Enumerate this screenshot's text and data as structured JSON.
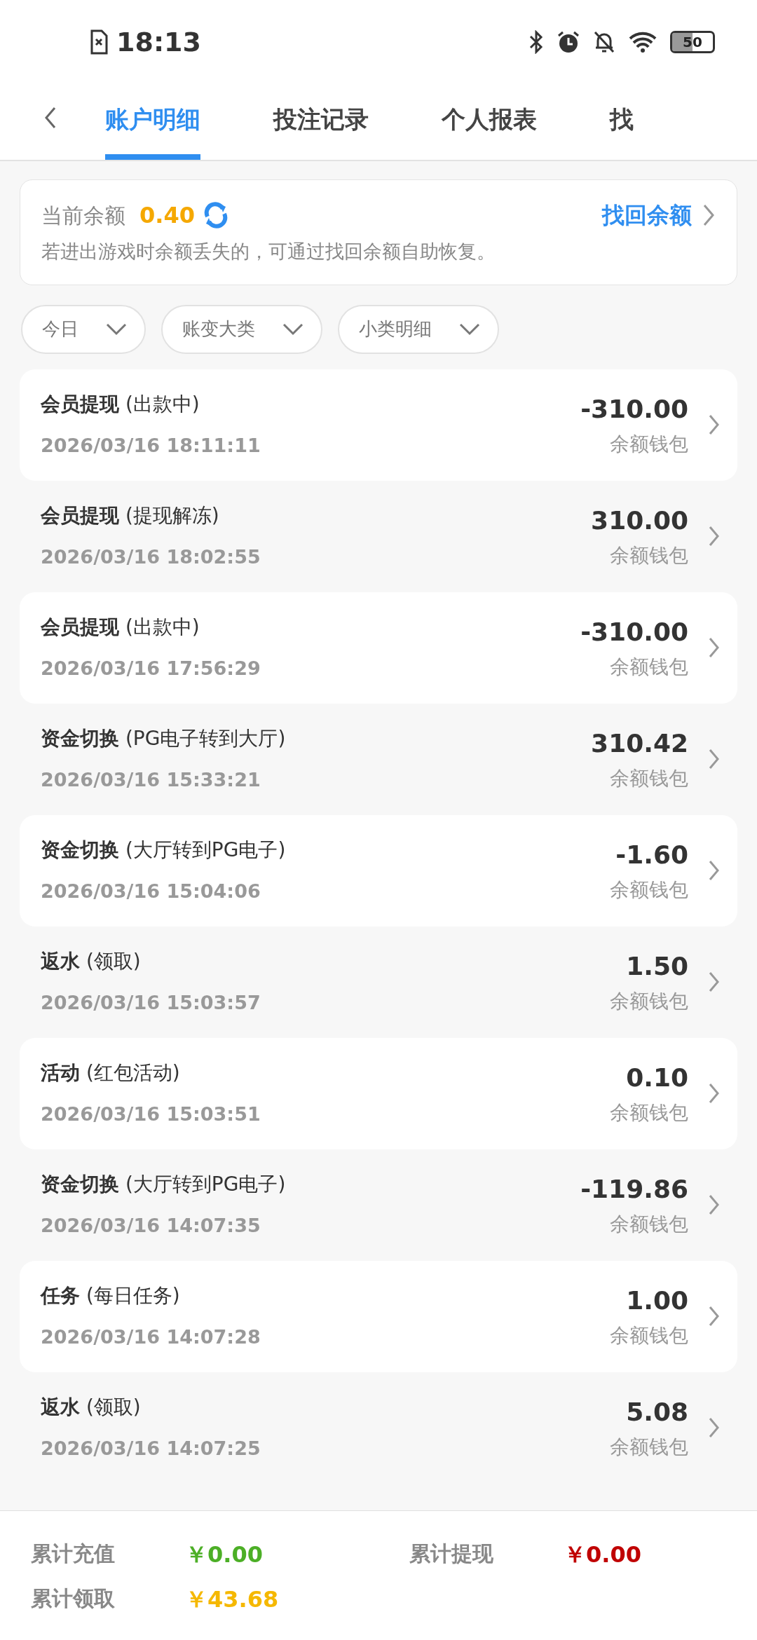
{
  "status_bar": {
    "time": "18:13",
    "battery": "50"
  },
  "tabs": [
    {
      "label": "账户明细",
      "selected": true
    },
    {
      "label": "投注记录",
      "selected": false
    },
    {
      "label": "个人报表",
      "selected": false
    },
    {
      "label": "找",
      "selected": false
    }
  ],
  "balance_card": {
    "label": "当前余额",
    "amount": "0.40",
    "recover_link": "找回余额",
    "note": "若进出游戏时余额丢失的，可通过找回余额自助恢复。"
  },
  "filters": [
    {
      "label": "今日"
    },
    {
      "label": "账变大类"
    },
    {
      "label": "小类明细"
    }
  ],
  "transactions": [
    {
      "title": "**会员提现** (出款中)",
      "time": "2026/03/16 18:11:11",
      "amount": "-310.00",
      "wallet": "余额钱包"
    },
    {
      "title": "**会员提现** (提现解冻)",
      "time": "2026/03/16 18:02:55",
      "amount": "310.00",
      "wallet": "余额钱包"
    },
    {
      "title": "**会员提现** (出款中)",
      "time": "2026/03/16 17:56:29",
      "amount": "-310.00",
      "wallet": "余额钱包"
    },
    {
      "title": "**资金切换** (PG电子转到大厅)",
      "time": "2026/03/16 15:33:21",
      "amount": "310.42",
      "wallet": "余额钱包"
    },
    {
      "title": "**资金切换** (大厅转到PG电子)",
      "time": "2026/03/16 15:04:06",
      "amount": "-1.60",
      "wallet": "余额钱包"
    },
    {
      "title": "**返水** (领取)",
      "time": "2026/03/16 15:03:57",
      "amount": "1.50",
      "wallet": "余额钱包"
    },
    {
      "title": "**活动** (红包活动)",
      "time": "2026/03/16 15:03:51",
      "amount": "0.10",
      "wallet": "余额钱包"
    },
    {
      "title": "**资金切换** (大厅转到PG电子)",
      "time": "2026/03/16 14:07:35",
      "amount": "-119.86",
      "wallet": "余额钱包"
    },
    {
      "title": "**任务** (每日任务)",
      "time": "2026/03/16 14:07:28",
      "amount": "1.00",
      "wallet": "余额钱包"
    },
    {
      "title": "**返水** (领取)",
      "time": "2026/03/16 14:07:25",
      "amount": "5.08",
      "wallet": "余额钱包"
    }
  ],
  "totals": [
    {
      "label": "累计充值",
      "value": "￥0.00",
      "color": "#4caf26"
    },
    {
      "label": "累计提现",
      "value": "￥0.00",
      "color": "#c00000"
    },
    {
      "label": "累计领取",
      "value": "￥43.68",
      "color": "#f5b800"
    }
  ]
}
